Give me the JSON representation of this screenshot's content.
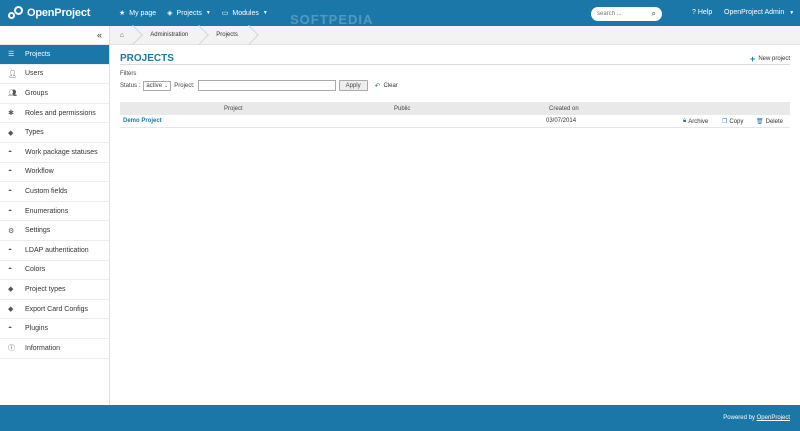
{
  "header": {
    "logo_text": "OpenProject",
    "nav": [
      {
        "label": "My page",
        "icon": "star-icon"
      },
      {
        "label": "Projects",
        "icon": "projects-icon"
      },
      {
        "label": "Modules",
        "icon": "modules-icon"
      }
    ],
    "search_placeholder": "search ...",
    "help_label": "Help",
    "user_label": "OpenProject Admin",
    "watermark": "SOFTPEDIA",
    "accent_color": "#1a77a8"
  },
  "breadcrumb": {
    "home_icon": "home-icon",
    "items": [
      "Administration",
      "Projects"
    ]
  },
  "sidebar": {
    "collapse_icon": "double-chevron-left-icon",
    "items": [
      {
        "label": "Projects",
        "icon": "list-icon",
        "active": true
      },
      {
        "label": "Users",
        "icon": "user-icon"
      },
      {
        "label": "Groups",
        "icon": "group-icon"
      },
      {
        "label": "Roles and permissions",
        "icon": "gear-icon"
      },
      {
        "label": "Types",
        "icon": "tag-icon"
      },
      {
        "label": "Work package statuses",
        "icon": "gauge-icon"
      },
      {
        "label": "Workflow",
        "icon": "gauge-icon"
      },
      {
        "label": "Custom fields",
        "icon": "gauge-icon"
      },
      {
        "label": "Enumerations",
        "icon": "gauge-icon"
      },
      {
        "label": "Settings",
        "icon": "gears-icon"
      },
      {
        "label": "LDAP authentication",
        "icon": "gauge-icon"
      },
      {
        "label": "Colors",
        "icon": "gauge-icon"
      },
      {
        "label": "Project types",
        "icon": "tag-icon"
      },
      {
        "label": "Export Card Configs",
        "icon": "tag-icon"
      },
      {
        "label": "Plugins",
        "icon": "gauge-icon"
      },
      {
        "label": "Information",
        "icon": "info-icon"
      }
    ]
  },
  "main": {
    "title": "PROJECTS",
    "new_project_label": "New project",
    "filters": {
      "label": "Filters",
      "status_label": "Status :",
      "status_value": "active",
      "project_label": "Project:",
      "project_value": "",
      "apply_label": "Apply",
      "clear_label": "Clear"
    },
    "table": {
      "columns": [
        "Project",
        "Public",
        "Created on"
      ],
      "rows": [
        {
          "project": "Demo Project",
          "public": "",
          "created_on": "03/07/2014",
          "actions": [
            "Archive",
            "Copy",
            "Delete"
          ]
        }
      ]
    }
  },
  "footer": {
    "powered_by": "Powered by",
    "link_text": "OpenProject"
  }
}
